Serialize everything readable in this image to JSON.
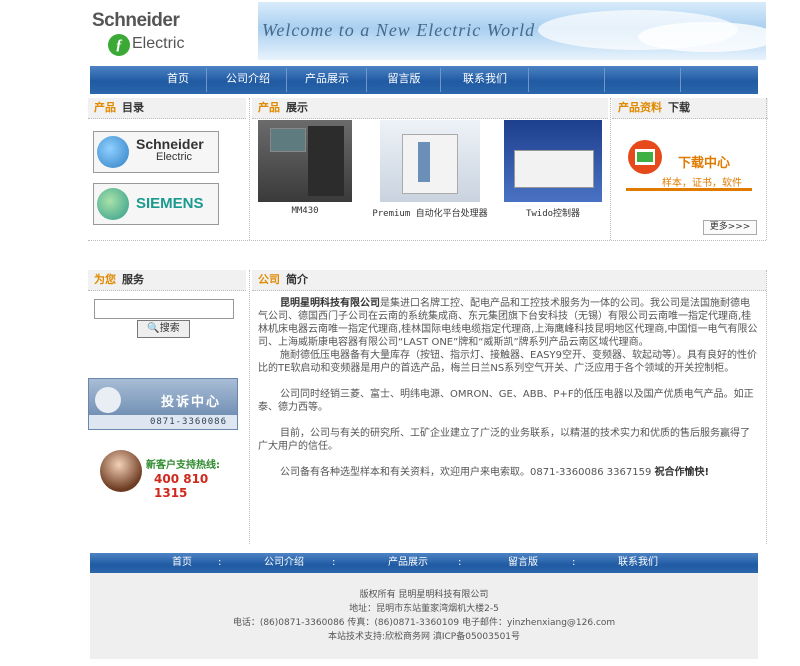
{
  "header": {
    "logo_text_top": "Schneider",
    "logo_text_bottom": "Electric",
    "banner_text": "Welcome to a New Electric World"
  },
  "nav": {
    "items": [
      "首页",
      "公司介绍",
      "产品展示",
      "留言版",
      "联系我们"
    ]
  },
  "sections": {
    "products_catalog": {
      "hl": "产品",
      "rest": "目录"
    },
    "products_show": {
      "hl": "产品",
      "rest": "展示"
    },
    "downloads": {
      "hl": "产品资料",
      "rest": "下载"
    },
    "service": {
      "hl": "为您",
      "rest": "服务"
    },
    "company": {
      "hl": "公司",
      "rest": "简介"
    }
  },
  "brands": [
    {
      "name": "Schneider Electric",
      "line1": "Schneider",
      "line2": "Electric"
    },
    {
      "name": "SIEMENS",
      "line1": "SIEMENS"
    }
  ],
  "products": [
    {
      "caption": "MM430"
    },
    {
      "caption": "Premium 自动化平台处理器"
    },
    {
      "caption": "Twido控制器"
    }
  ],
  "download": {
    "title": "下载中心",
    "subtitle": "样本，证书，软件"
  },
  "more_label": "更多>>>",
  "search": {
    "placeholder": "",
    "button": "搜索"
  },
  "complaint": {
    "title": "投诉中心",
    "phone": "0871-3360086"
  },
  "hotline": {
    "label": "新客户支持热线:",
    "number": "400 810 1315"
  },
  "intro": {
    "company_name": "昆明星明科技有限公司",
    "p1": "是集进口名牌工控、配电产品和工控技术服务为一体的公司。我公司是法国施耐德电气公司、德国西门子公司在云南的系统集成商、东元集团旗下台安科技（无锡）有限公司云南唯一指定代理商,桂林机床电器云南唯一指定代理商,桂林国际电线电缆指定代理商,上海鹰峰科技昆明地区代理商,中国恒一电气有限公司、上海威斯康电容器有限公司“LAST ONE”牌和“威斯凯”牌系列产品云南区域代理商。",
    "p2": "施耐德低压电器备有大量库存（按钮、指示灯、接触器、EASY9空开、变频器、软起动等）。具有良好的性价比的TE软启动和变频器是用户的首选产品，梅兰日兰NS系列空气开关、广泛应用于各个领域的开关控制柜。",
    "p3": "公司同时经销三菱、富士、明纬电源、OMRON、GE、ABB、P+F的低压电器以及国产优质电气产品。如正泰、德力西等。",
    "p4": "目前，公司与有关的研究所、工矿企业建立了广泛的业务联系，以精湛的技术实力和优质的售后服务赢得了广大用户的信任。",
    "p5": "公司备有各种选型样本和有关资料，欢迎用户来电索取。0871-3360086 3367159",
    "p5_bold": "祝合作愉快!"
  },
  "footer": {
    "nav": [
      "首页",
      "公司介绍",
      "产品展示",
      "留言版",
      "联系我们"
    ],
    "sep": ":",
    "copyright": "版权所有 昆明星明科技有限公司",
    "address": "地址：昆明市东站董家湾烟机大楼2-5",
    "contact": "电话：(86)0871-3360086 传真：(86)0871-3360109 电子邮件：yinzhenxiang@126.com",
    "support": "本站技术支持:欣松商务网 滇ICP备05003501号"
  }
}
